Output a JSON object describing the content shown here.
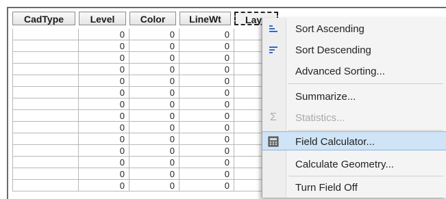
{
  "table": {
    "columns": [
      {
        "label": "CadType"
      },
      {
        "label": "Level"
      },
      {
        "label": "Color"
      },
      {
        "label": "LineWt"
      },
      {
        "label": "Laye"
      }
    ],
    "rows": [
      [
        "",
        "0",
        "0",
        "0",
        ""
      ],
      [
        "",
        "0",
        "0",
        "0",
        ""
      ],
      [
        "",
        "0",
        "0",
        "0",
        ""
      ],
      [
        "",
        "0",
        "0",
        "0",
        ""
      ],
      [
        "",
        "0",
        "0",
        "0",
        ""
      ],
      [
        "",
        "0",
        "0",
        "0",
        ""
      ],
      [
        "",
        "0",
        "0",
        "0",
        ""
      ],
      [
        "",
        "0",
        "0",
        "0",
        ""
      ],
      [
        "",
        "0",
        "0",
        "0",
        ""
      ],
      [
        "",
        "0",
        "0",
        "0",
        ""
      ],
      [
        "",
        "0",
        "0",
        "0",
        ""
      ],
      [
        "",
        "0",
        "0",
        "0",
        ""
      ],
      [
        "",
        "0",
        "0",
        "0",
        ""
      ],
      [
        "",
        "0",
        "0",
        "0",
        ""
      ]
    ]
  },
  "context_menu": {
    "items": [
      {
        "label": "Sort Ascending",
        "icon": "sort-ascending-icon"
      },
      {
        "label": "Sort Descending",
        "icon": "sort-descending-icon"
      },
      {
        "label": "Advanced Sorting...",
        "icon": ""
      },
      {
        "label": "Summarize...",
        "icon": ""
      },
      {
        "label": "Statistics...",
        "icon": "sigma-icon",
        "disabled": true
      },
      {
        "label": "Field Calculator...",
        "icon": "calculator-icon",
        "highlighted": true
      },
      {
        "label": "Calculate Geometry...",
        "icon": ""
      },
      {
        "label": "Turn Field Off",
        "icon": ""
      }
    ]
  },
  "colors": {
    "highlight": "#cfe4f6",
    "highlight_border": "#8bb6dc",
    "sort_icon_blue": "#2a6fc4",
    "cursor_glow": "#f0e15a"
  }
}
